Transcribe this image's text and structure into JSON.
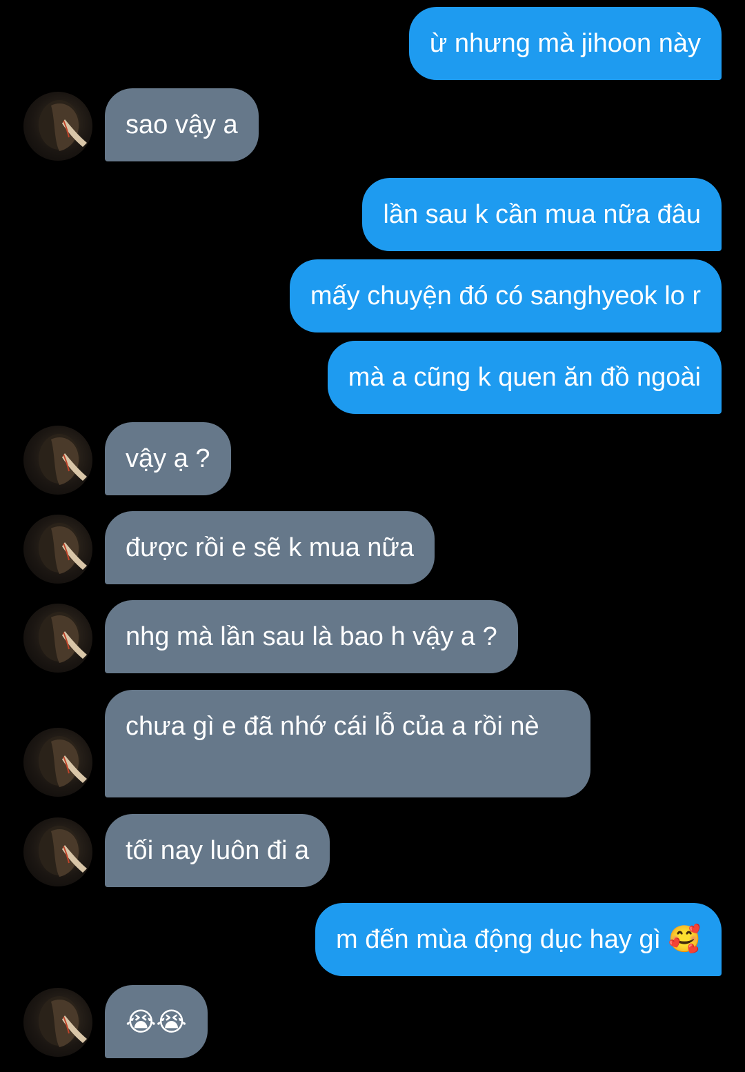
{
  "colors": {
    "background": "#000000",
    "outgoing_bubble": "#1e9bf0",
    "incoming_bubble": "#66788a",
    "text": "#ffffff"
  },
  "contact": {
    "avatar_icon": "profile-photo-avatar"
  },
  "messages": [
    {
      "direction": "out",
      "text": "ừ nhưng mà jihoon này"
    },
    {
      "direction": "in",
      "text": "sao vậy a"
    },
    {
      "direction": "out",
      "text": "lần sau k cần mua nữa đâu"
    },
    {
      "direction": "out",
      "text": "mấy chuyện đó có sanghyeok lo r"
    },
    {
      "direction": "out",
      "text": "mà a cũng k quen ăn đồ ngoài"
    },
    {
      "direction": "in",
      "text": "vậy ạ ?"
    },
    {
      "direction": "in",
      "text": "được rồi e sẽ k mua nữa"
    },
    {
      "direction": "in",
      "text": "nhg mà lần sau là bao h vậy a ?"
    },
    {
      "direction": "in",
      "text": "chưa gì e đã nhớ cái lỗ của a rồi nè"
    },
    {
      "direction": "in",
      "text": "tối nay luôn đi a"
    },
    {
      "direction": "out",
      "text": "m đến mùa động dục hay gì 🥰"
    },
    {
      "direction": "in",
      "text": "😭😭"
    }
  ]
}
